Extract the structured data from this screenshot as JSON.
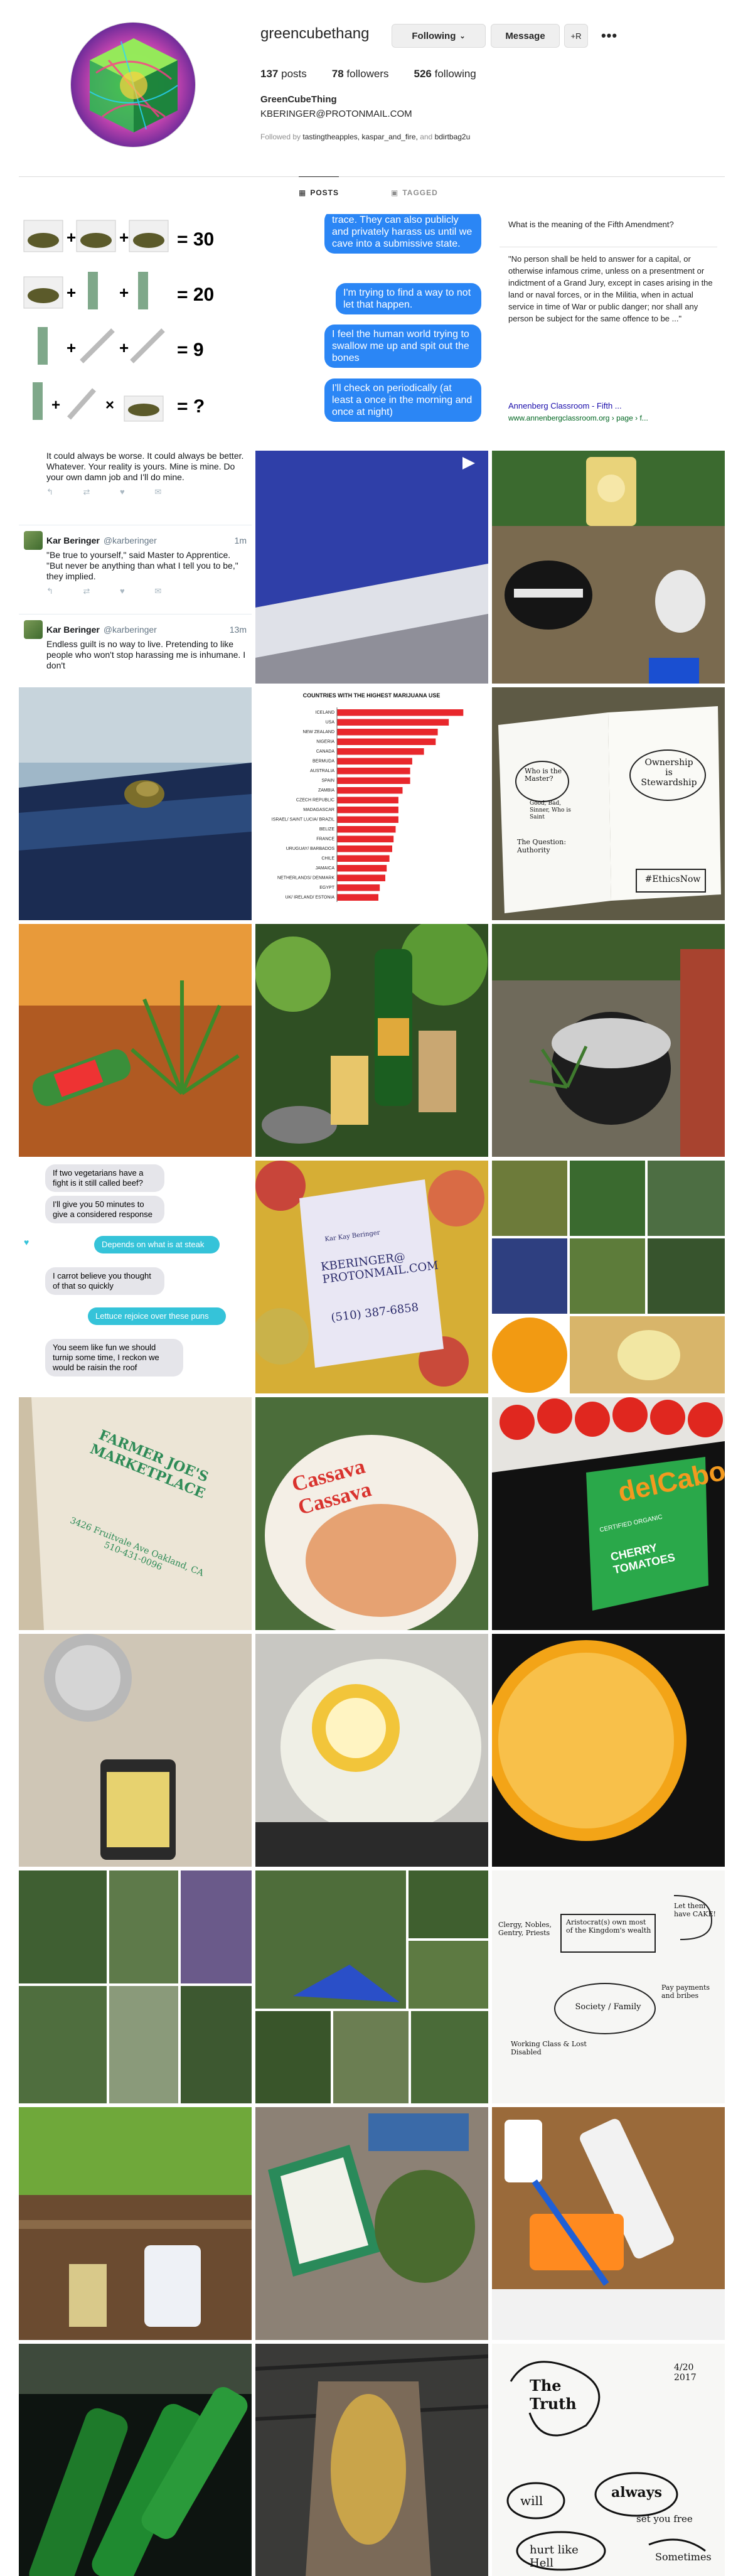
{
  "profile": {
    "username": "greencubethang",
    "following_button": "Following",
    "message_button": "Message",
    "suggest_button": "+R",
    "more_icon": "•••",
    "stats": {
      "posts": "137",
      "posts_label": "posts",
      "followers": "78",
      "followers_label": "followers",
      "following": "526",
      "following_label": "following"
    },
    "full_name": "GreenCubeThing",
    "bio": "KBERINGER@PROTONMAIL.COM",
    "followed_by_prefix": "Followed by",
    "followed_by_names": "tastingtheapples, kaspar_and_fire,",
    "followed_by_and": "and",
    "followed_by_last": "bdirtbag2u"
  },
  "tabs": {
    "posts": "POSTS",
    "tagged": "TAGGED"
  },
  "puzzle": {
    "r1": "= 30",
    "r2": "= 20",
    "r3": "= 9",
    "r4": "= ?",
    "plus": "+",
    "times": "×"
  },
  "tweets": {
    "t0_body": "It could always be worse. It could always be better. Whatever. Your reality is yours. Mine is mine. Do your own damn job and I'll do mine.",
    "t1_name": "Kar Beringer",
    "t1_handle": "@karberinger",
    "t1_time": "1m",
    "t1_body": "\"Be true to yourself,\" said Master to Apprentice. \"But never be anything than what I tell you to be,\" they implied.",
    "t2_name": "Kar Beringer",
    "t2_handle": "@karberinger",
    "t2_time": "13m",
    "t2_body": "Endless guilt is no way to live. Pretending to like people who won't stop harassing me is inhumane. I don't",
    "actions": "↰ ⇄ ♥ ✉"
  },
  "imessage1": {
    "b1": "trace. They can also publicly and privately harass us until we cave into a submissive state.",
    "b2": "I'm trying to find a way to not let that happen.",
    "b3": "I feel the human world trying to swallow me up and spit out the bones",
    "b4": "I'll check on periodically (at least a once in the morning and once at night)"
  },
  "snippet": {
    "question": "What is the meaning of the Fifth Amendment?",
    "body": "\"No person shall be held to answer for a capital, or otherwise infamous crime, unless on a presentment or indictment of a Grand Jury, except in cases arising in the land or naval forces, or in the Militia, when in actual service in time of War or public danger; nor shall any person be subject for the same offence to be ...\"",
    "link": "Annenberg Classroom - Fifth ...",
    "url": "www.annenbergclassroom.org › page › f..."
  },
  "chart_data": {
    "type": "bar",
    "title": "COUNTRIES WITH THE HIGHEST MARIJUANA USE",
    "categories": [
      "ICELAND",
      "USA",
      "NEW ZEALAND",
      "NIGERIA",
      "CANADA",
      "BERMUDA",
      "AUSTRALIA",
      "SPAIN",
      "ZAMBIA",
      "CZECH REPUBLIC",
      "MADAGASCAR",
      "ISRAEL/ SAINT LUCIA/ BRAZIL",
      "BELIZE",
      "FRANCE",
      "URUGUAY/ BARBADOS",
      "CHILE",
      "JAMAICA",
      "NETHERLANDS/ DENMARK",
      "EGYPT",
      "UK/ IRELAND/ ESTONIA"
    ],
    "values": [
      18.3,
      16.2,
      14.6,
      14.3,
      12.6,
      10.9,
      10.6,
      10.6,
      9.5,
      8.9,
      8.9,
      8.9,
      8.5,
      8.2,
      8.0,
      7.6,
      7.2,
      7.0,
      6.2,
      6.0
    ],
    "xlim": [
      0,
      20
    ],
    "bar_color": "#e8272c"
  },
  "imessage2": {
    "g1": "If two vegetarians have a fight is it still called beef?",
    "g2": "I'll give you 50 minutes to give a considered response",
    "t1": "Depends on what is at steak",
    "g3": "I carrot believe you thought of that so quickly",
    "t2": "Lettuce rejoice over these puns",
    "g4": "You seem like fun we should turnip some time, I reckon we would be raisin the roof"
  },
  "handwritten": {
    "left_q": "Who is the Master?",
    "left_sub": "Good, Bad, Sinner, Who is Saint",
    "left_q2": "The Question: Authority",
    "right_title": "Ownership is Stewardship",
    "right_sub": "#EthicsNow",
    "card_name": "Kar Kay Beringer",
    "card_email": "KBERINGER@ PROTONMAIL.COM",
    "card_phone": "(510) 387-6858",
    "bag_text": "FARMER JOE'S MARKETPLACE",
    "bag_addr": "3426 Fruitvale Ave Oakland, CA 510-431-0096",
    "cherry_brand": "delCabo",
    "cherry_label": "CHERRY TOMATOES",
    "cherry_organic": "CERTIFIED ORGANIC",
    "cassava": "Cassava Cassava",
    "diagram_a": "Aristocrat(s) own most of the Kingdom's wealth",
    "diagram_b": "Let them have CAKE!",
    "diagram_c": "Clergy, Nobles, Gentry, Priests",
    "diagram_d": "Society / Family",
    "diagram_e": "Working Class & Lost Disabled",
    "diagram_f": "Pay payments and bribes",
    "truth_a": "The Truth",
    "truth_b": "will",
    "truth_c": "always",
    "truth_d": "set you free",
    "truth_e": "hurt like Hell",
    "truth_f": "Sometimes",
    "truth_date": "4/20 2017"
  },
  "colors": {
    "accent_blue": "#2b86f5",
    "imessage_teal": "#35c3d9",
    "border": "#dbdbdb",
    "muted": "#8e8e8e"
  }
}
